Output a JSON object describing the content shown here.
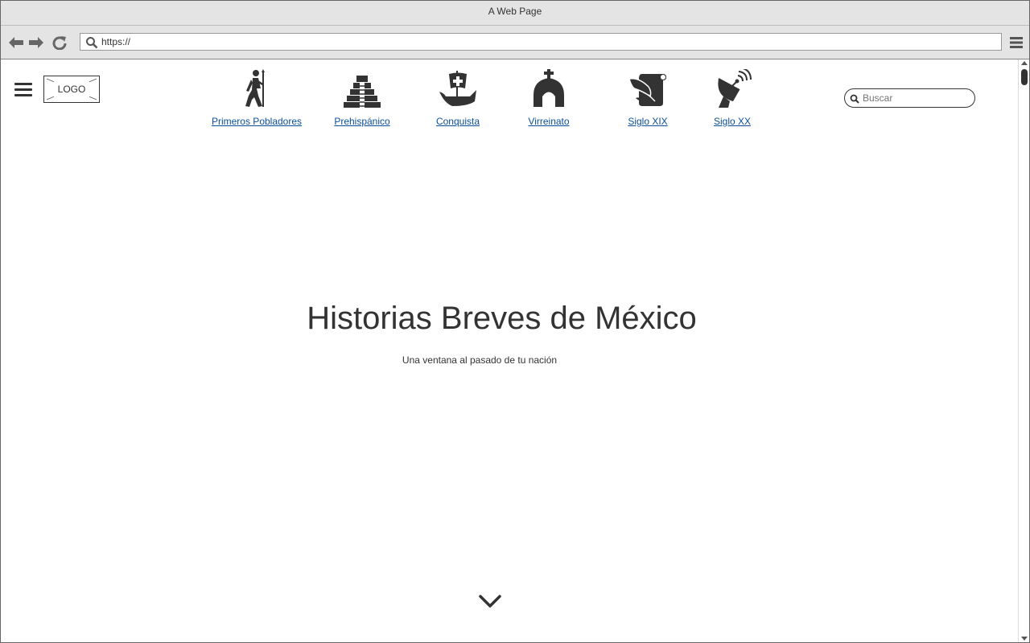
{
  "window": {
    "title": "A Web Page"
  },
  "toolbar": {
    "url_value": "https://",
    "url_placeholder": "https://"
  },
  "header": {
    "logo_text": "LOGO"
  },
  "nav": {
    "items": [
      {
        "label": "Primeros Pobladores",
        "icon": "hiker-icon"
      },
      {
        "label": "Prehispánico",
        "icon": "pyramid-icon"
      },
      {
        "label": "Conquista",
        "icon": "ship-icon"
      },
      {
        "label": "Virreinato",
        "icon": "church-icon"
      },
      {
        "label": "Siglo XIX",
        "icon": "scroll-quill-icon"
      },
      {
        "label": "Siglo XX",
        "icon": "satellite-dish-icon"
      }
    ]
  },
  "search": {
    "placeholder": "Buscar"
  },
  "hero": {
    "title": "Historias Breves de México",
    "subtitle": "Una ventana al pasado de tu nación"
  },
  "colors": {
    "link": "#0b4f9a",
    "chrome": "#e4e4e4",
    "text": "#333333"
  }
}
